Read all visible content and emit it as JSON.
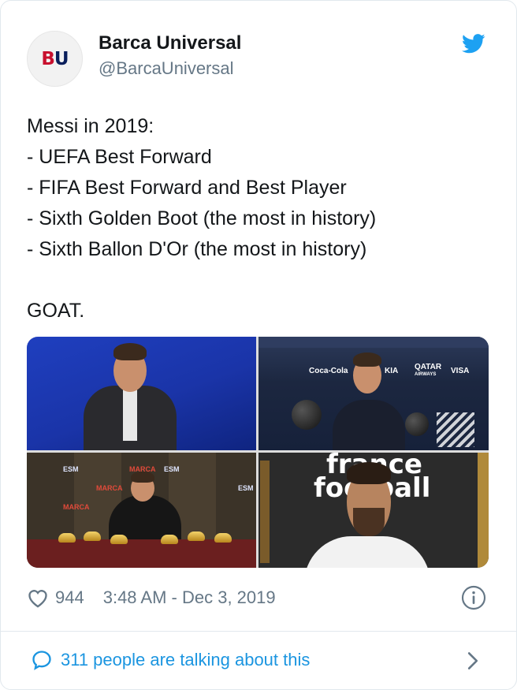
{
  "header": {
    "avatar_text_b": "B",
    "avatar_text_u": "U",
    "display_name": "Barca Universal",
    "handle": "@BarcaUniversal",
    "brand_icon": "twitter-bird-icon",
    "brand_color": "#1da1f2"
  },
  "tweet": {
    "lines": [
      "Messi in 2019:",
      "- UEFA Best Forward",
      "- FIFA Best Forward and Best Player",
      "- Sixth Golden Boot (the most in history)",
      "- Sixth Ballon D'Or (the most in history)",
      "GOAT."
    ]
  },
  "media": {
    "photo2_sponsors": [
      "Coca-Cola",
      "KIA",
      "QATAR",
      "AIRWAYS",
      "VISA"
    ],
    "photo3_banner": [
      "ESM",
      "MARCA",
      "ESM",
      "MARCA",
      "ESM",
      "MARCA"
    ],
    "photo4_magazine_line1": "france",
    "photo4_magazine_line2": "football"
  },
  "meta": {
    "likes": "944",
    "timestamp": "3:48 AM - Dec 3, 2019"
  },
  "footer": {
    "talking": "311 people are talking about this"
  },
  "colors": {
    "accent": "#1b95e0",
    "secondary_text": "#657786",
    "divider": "#e1e8ed"
  }
}
